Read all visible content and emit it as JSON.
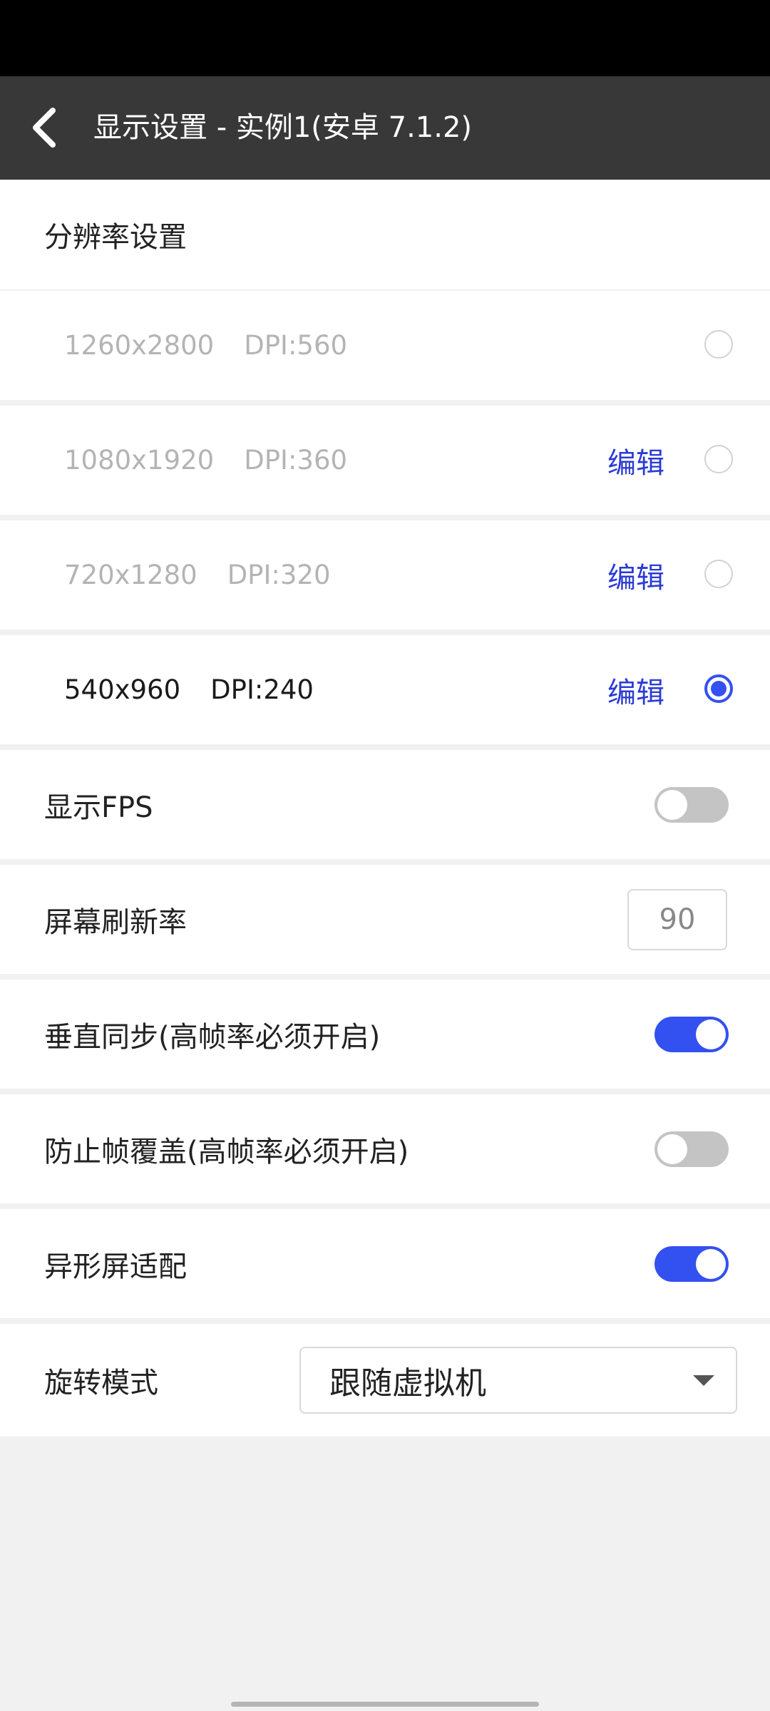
{
  "header": {
    "title": "显示设置 - 实例1(安卓 7.1.2)"
  },
  "resolution": {
    "section_title": "分辨率设置",
    "edit_label": "编辑",
    "options": [
      {
        "resolution": "1260x2800",
        "dpi": "DPI:560",
        "selected": false,
        "editable": false
      },
      {
        "resolution": "1080x1920",
        "dpi": "DPI:360",
        "selected": false,
        "editable": true
      },
      {
        "resolution": "720x1280",
        "dpi": "DPI:320",
        "selected": false,
        "editable": true
      },
      {
        "resolution": "540x960",
        "dpi": "DPI:240",
        "selected": true,
        "editable": true
      }
    ]
  },
  "settings": {
    "show_fps": {
      "label": "显示FPS",
      "on": false
    },
    "refresh_rate": {
      "label": "屏幕刷新率",
      "value": "90"
    },
    "vsync": {
      "label": "垂直同步(高帧率必须开启)",
      "on": true
    },
    "prevent_overwrite": {
      "label": "防止帧覆盖(高帧率必须开启)",
      "on": false
    },
    "notch_adapt": {
      "label": "异形屏适配",
      "on": true
    },
    "rotation": {
      "label": "旋转模式",
      "value": "跟随虚拟机"
    }
  },
  "colors": {
    "accent": "#3350f0",
    "link": "#2b3bd4",
    "app_bar": "#383838"
  }
}
